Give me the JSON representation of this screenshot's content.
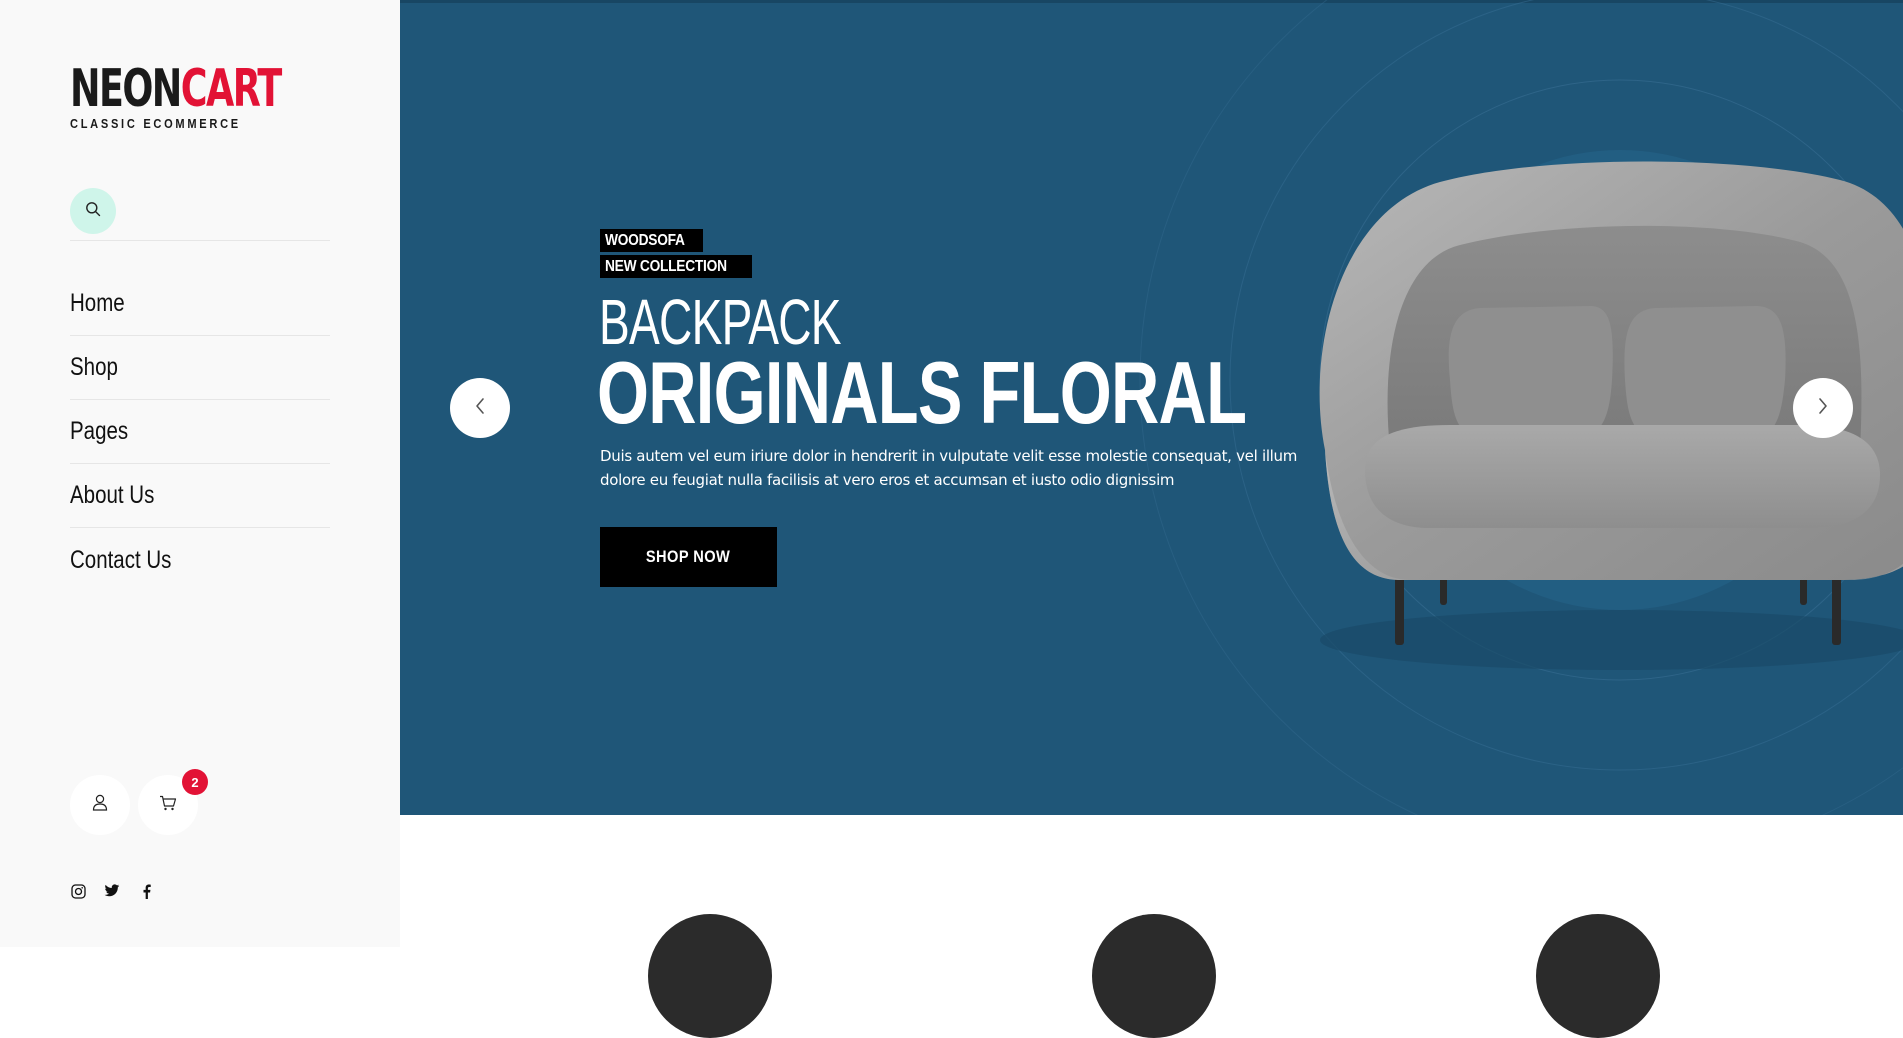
{
  "brand": {
    "name_part1": "NEON",
    "name_part2": "CART",
    "tagline": "CLASSIC ECOMMERCE"
  },
  "colors": {
    "accent": "#e21235",
    "hero_bg": "#1f5678",
    "search_bg": "#cff5ea",
    "sidebar_bg": "#f9f9f9"
  },
  "search": {
    "icon": "search-icon"
  },
  "nav": {
    "items": [
      {
        "label": "Home"
      },
      {
        "label": "Shop"
      },
      {
        "label": "Pages"
      },
      {
        "label": "About Us"
      },
      {
        "label": "Contact Us"
      }
    ]
  },
  "account": {
    "icon": "user-icon"
  },
  "cart": {
    "icon": "cart-icon",
    "count": "2"
  },
  "social": [
    "instagram-icon",
    "twitter-icon",
    "facebook-icon"
  ],
  "hero": {
    "tag_line1": "WOODSOFA",
    "tag_line2": "NEW COLLECTION",
    "title_light": "BACKPACK",
    "title_bold": "ORIGINALS FLORAL",
    "description": "Duis autem vel eum iriure dolor in hendrerit in vulputate velit esse molestie consequat, vel illum dolore eu feugiat nulla facilisis at vero eros et accumsan et iusto odio dignissim",
    "cta_label": "SHOP NOW",
    "prev_icon": "chevron-left-icon",
    "next_icon": "chevron-right-icon"
  }
}
